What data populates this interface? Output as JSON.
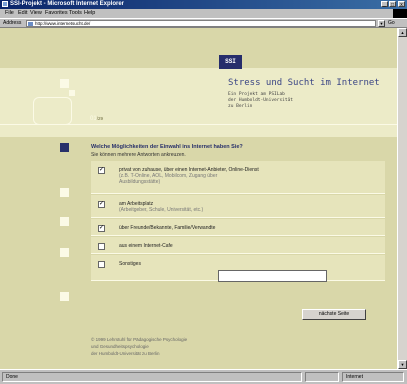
{
  "window": {
    "title": "SSI-Projekt - Microsoft Internet Explorer",
    "controls": [
      "_",
      "□",
      "x"
    ]
  },
  "menu": {
    "items": [
      "File",
      "Edit",
      "View",
      "Favorites",
      "Tools",
      "Help"
    ]
  },
  "address": {
    "label": "Address",
    "url": "http://www.internetsucht.de/",
    "go_label": "Go"
  },
  "page": {
    "logo_text": "SSI",
    "site_title": "Stress und Sucht im Internet",
    "subtitle_lines": [
      "Ein Projekt am PSILab",
      "der Humboldt-Universität",
      "zu Berlin"
    ],
    "progress_current": "01",
    "progress_total": "/29",
    "question": "Welche Möglichkeiten der Einwahl ins Internet haben Sie?",
    "hint": "Sie können mehrere Antworten ankreuzen.",
    "options": [
      {
        "label": "privat von zuhause, über einen Internet-Anbieter, Online-Dienst",
        "detail": [
          "(z.B. T-Online, AOL, Mobilcom, Zugang über",
          "Ausbildungsstätte)"
        ],
        "checked": "✓"
      },
      {
        "label": "am Arbeitsplatz",
        "detail": [
          "(Arbeitgeber, Schule, Universität, etc.)"
        ],
        "checked": "✓"
      },
      {
        "label": "über Freunde/Bekannte, Familie/Verwandte",
        "detail": [],
        "checked": "✓"
      },
      {
        "label": "aus einem Internet-Cafe",
        "detail": [],
        "checked": ""
      },
      {
        "label": "Sonstiges",
        "detail": [],
        "checked": ""
      }
    ],
    "next_button": "nächste Seite",
    "footer": [
      "© 1999 Lehrstuhl für Pädagogische Psychologie",
      "und Gesundheitspsychologie",
      "der Humboldt-Universität zu Berlin"
    ]
  },
  "status": {
    "text": "Done",
    "zone": "Internet"
  }
}
